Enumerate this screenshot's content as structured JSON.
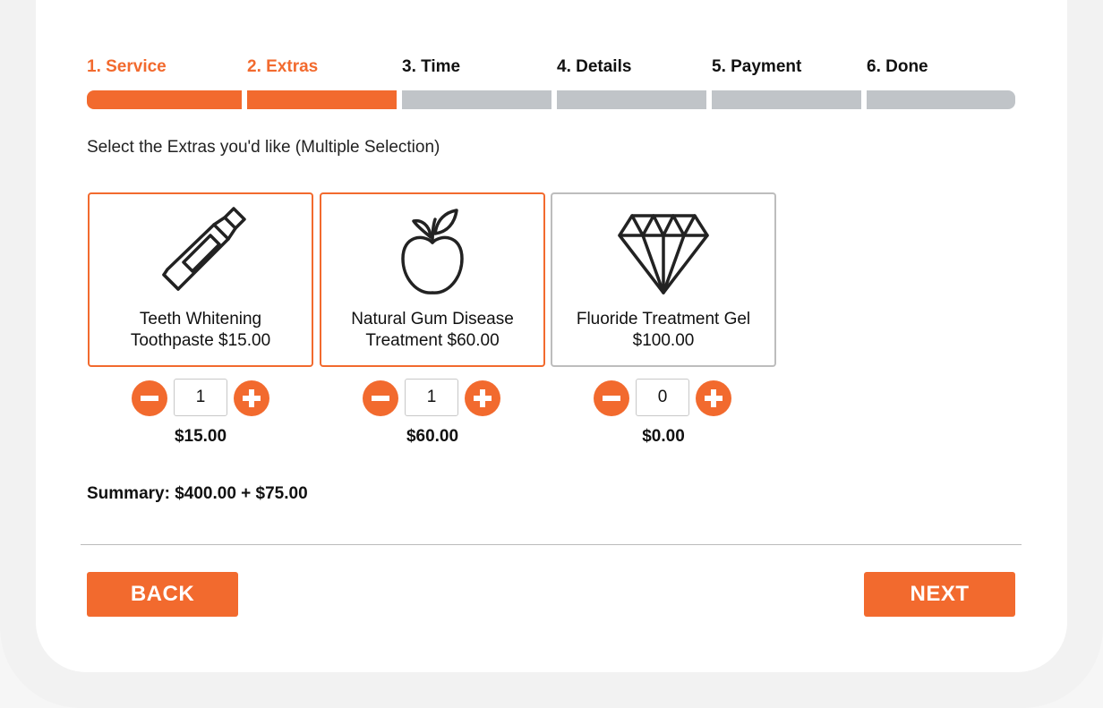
{
  "steps": [
    {
      "label": "1. Service",
      "active": true
    },
    {
      "label": "2. Extras",
      "active": true
    },
    {
      "label": "3. Time",
      "active": false
    },
    {
      "label": "4. Details",
      "active": false
    },
    {
      "label": "5. Payment",
      "active": false
    },
    {
      "label": "6. Done",
      "active": false
    }
  ],
  "instruction": "Select the Extras you'd like (Multiple Selection)",
  "extras": [
    {
      "name": "Teeth Whitening Toothpaste $15.00",
      "icon": "toothpaste-icon",
      "quantity": "1",
      "subtotal": "$15.00",
      "selected": true
    },
    {
      "name": "Natural Gum Disease Treatment $60.00",
      "icon": "apple-icon",
      "quantity": "1",
      "subtotal": "$60.00",
      "selected": true
    },
    {
      "name": "Fluoride Treatment Gel $100.00",
      "icon": "diamond-icon",
      "quantity": "0",
      "subtotal": "$0.00",
      "selected": false
    }
  ],
  "summary": "Summary: $400.00 + $75.00",
  "buttons": {
    "back": "BACK",
    "next": "NEXT"
  },
  "colors": {
    "accent": "#f26a2e",
    "inactive": "#c0c4c8",
    "unselected_border": "#bdbdbd"
  }
}
